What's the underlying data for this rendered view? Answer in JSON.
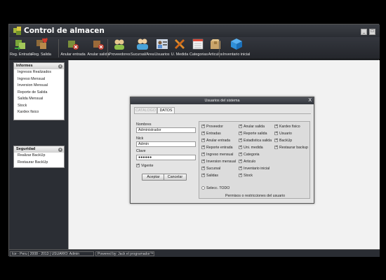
{
  "app": {
    "title": "Control de almacen",
    "window_buttons": [
      "_",
      "□"
    ]
  },
  "toolbar": {
    "items": [
      {
        "label": "Reg. Entrada",
        "icon": "boxes-in-icon",
        "color": "#7aa63a"
      },
      {
        "label": "Reg. Salida",
        "icon": "boxes-out-icon",
        "color": "#c0392b"
      },
      {
        "label": "Anular entrada",
        "icon": "cancel-entry-icon",
        "color": "#6b8f3a"
      },
      {
        "label": "Anular salida",
        "icon": "cancel-exit-icon",
        "color": "#b03a2e"
      },
      {
        "label": "Proveedores",
        "icon": "suppliers-icon",
        "color": "#8fbf4a"
      },
      {
        "label": "Sucursal/Area",
        "icon": "branch-icon",
        "color": "#4aa3d8"
      },
      {
        "label": "Usuarios",
        "icon": "users-icon",
        "color": "#5b8fd0"
      },
      {
        "label": "U. Medida",
        "icon": "ruler-icon",
        "color": "#e08a2a"
      },
      {
        "label": "Categorias",
        "icon": "categories-icon",
        "color": "#d9d9d9"
      },
      {
        "label": "Articulos",
        "icon": "box-icon",
        "color": "#c9a46a"
      },
      {
        "label": "Inventario inicial",
        "icon": "inventory-icon",
        "color": "#2f8fd8"
      }
    ]
  },
  "sidebar": {
    "informes": {
      "title": "Informes",
      "items": [
        "Ingresos Realizados",
        "Ingreso Mensual",
        "Inversion Mensual",
        "Reporte de Salida",
        "Salida Mensual",
        "Stock",
        "Kardex fisico"
      ]
    },
    "seguridad": {
      "title": "Seguridad",
      "items": [
        "Realizar BackUp",
        "Restaurar BackUp"
      ]
    }
  },
  "status": {
    "left": "Ice - Peru | 2008 - 2013 | USUARIO: Admin",
    "right": "Powered by: Jack el programador™"
  },
  "dialog": {
    "title": "Usuarios del sistema",
    "close": "X",
    "tabs": [
      "CATALOGO",
      "DATOS"
    ],
    "active_tab": "DATOS",
    "form": {
      "nombres_label": "Nombres",
      "nombres_value": "Administrador",
      "nick_label": "Nick",
      "nick_value": "Admin",
      "clave_label": "Clave",
      "clave_value": "●●●●●●",
      "vigente_label": "Vigente",
      "vigente_checked": true
    },
    "buttons": {
      "accept": "Aceptar",
      "cancel": "Cancelar"
    },
    "permissions": {
      "col1": [
        "Proveedor",
        "Entradas",
        "Anular entrada",
        "Reporte entrada",
        "Ingreso mensual",
        "Inversion mensual",
        "Sucursal",
        "Salidas"
      ],
      "col2": [
        "Anular salida",
        "Reporte salida",
        "Estadistica salida",
        "Uni. medida",
        "Categoria",
        "Articulo",
        "Inventario inicial",
        "Stock"
      ],
      "col3": [
        "Kardex fisico",
        "Usuario",
        "BackUp",
        "Restaurar backup"
      ],
      "select_all": "Selecc. TODO",
      "caption": "Permisos o restricciones del usuario"
    }
  }
}
